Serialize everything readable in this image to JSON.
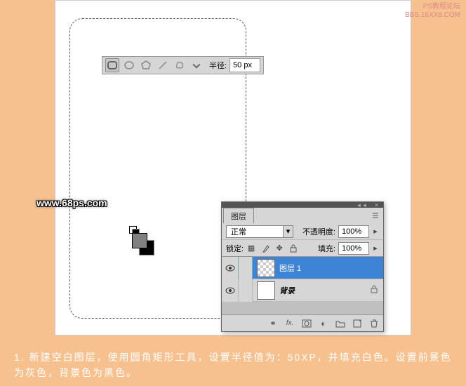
{
  "watermark_top": {
    "line1": "PS教程论坛",
    "line2": "BBS.16XX8.COM"
  },
  "watermark_68": "www.68ps.com",
  "tool_options": {
    "radius_label": "半径:",
    "radius_value": "50 px"
  },
  "swatches": {
    "fg": "#808080",
    "bg": "#000000"
  },
  "layers_panel": {
    "tab": "图层",
    "blend_label": "",
    "blend_mode": "正常",
    "opacity_label": "不透明度:",
    "opacity_value": "100%",
    "lock_label": "锁定:",
    "fill_label": "填充:",
    "fill_value": "100%",
    "layers": [
      {
        "name": "图层 1",
        "selected": true,
        "bg_layer": false
      },
      {
        "name": "背录",
        "selected": false,
        "bg_layer": true
      }
    ]
  },
  "caption": "1. 新建空白图层，使用圆角矩形工具，设置半径值为：50XP，并填充白色。设置前景色为灰色，背景色为黑色。"
}
